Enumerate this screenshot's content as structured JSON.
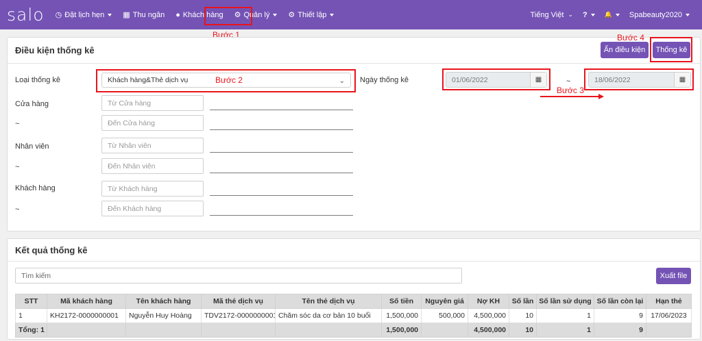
{
  "nav": {
    "logo": "salo",
    "items": [
      {
        "icon": "clock-icon",
        "glyph": "◷",
        "label": "Đặt lịch hẹn",
        "caret": true
      },
      {
        "icon": "book-icon",
        "glyph": "▦",
        "label": "Thu ngân",
        "caret": false
      },
      {
        "icon": "user-icon",
        "glyph": "●",
        "label": "Khách hàng",
        "caret": false
      },
      {
        "icon": "cubes-icon",
        "glyph": "⚙",
        "label": "Quản lý",
        "caret": true
      },
      {
        "icon": "cogs-icon",
        "glyph": "⚙",
        "label": "Thiết lập",
        "caret": true
      }
    ],
    "language": "Tiếng Việt",
    "help_glyph": "?",
    "bell_glyph": "🔔",
    "account": "Spabeauty2020"
  },
  "steps": {
    "step1": "Bước 1",
    "step2": "Bước 2",
    "step3": "Bước 3",
    "step4": "Bước 4"
  },
  "conditions": {
    "title": "Điều kiện thống kê",
    "hide_button": "Ẩn điều kiện",
    "stat_button": "Thống kê",
    "type_label": "Loại thống kê",
    "type_value": "Khách hàng&Thẻ dịch vụ",
    "date_label": "Ngày thống kê",
    "date_from": "01/06/2022",
    "date_sep": "~",
    "date_to": "18/06/2022",
    "store_label": "Cửa hàng",
    "store_from_ph": "Từ Cửa hàng",
    "store_to_ph": "Đến Cửa hàng",
    "staff_label": "Nhân viên",
    "staff_from_ph": "Từ Nhân viên",
    "staff_to_ph": "Đến Nhân viên",
    "customer_label": "Khách hàng",
    "customer_from_ph": "Từ Khách hàng",
    "customer_to_ph": "Đến Khách hàng",
    "tilde": "~"
  },
  "results": {
    "title": "Kết quả thống kê",
    "search_ph": "Tìm kiếm",
    "export_button": "Xuất file",
    "columns": [
      "STT",
      "Mã khách hàng",
      "Tên khách hàng",
      "Mã thẻ dịch vụ",
      "Tên thẻ dịch vụ",
      "Số tiền",
      "Nguyên giá",
      "Nợ KH",
      "Số lần",
      "Số lần sử dụng",
      "Số lần còn lại",
      "Hạn thẻ"
    ],
    "rows": [
      [
        "1",
        "KH2172-0000000001",
        "Nguyễn Huy Hoàng",
        "TDV2172-0000000001",
        "Chăm sóc da cơ bản 10 buổi",
        "1,500,000",
        "500,000",
        "4,500,000",
        "10",
        "1",
        "9",
        "17/06/2023"
      ]
    ],
    "total": [
      "Tổng: 1",
      "",
      "",
      "",
      "",
      "1,500,000",
      "",
      "4,500,000",
      "10",
      "1",
      "9",
      ""
    ]
  }
}
